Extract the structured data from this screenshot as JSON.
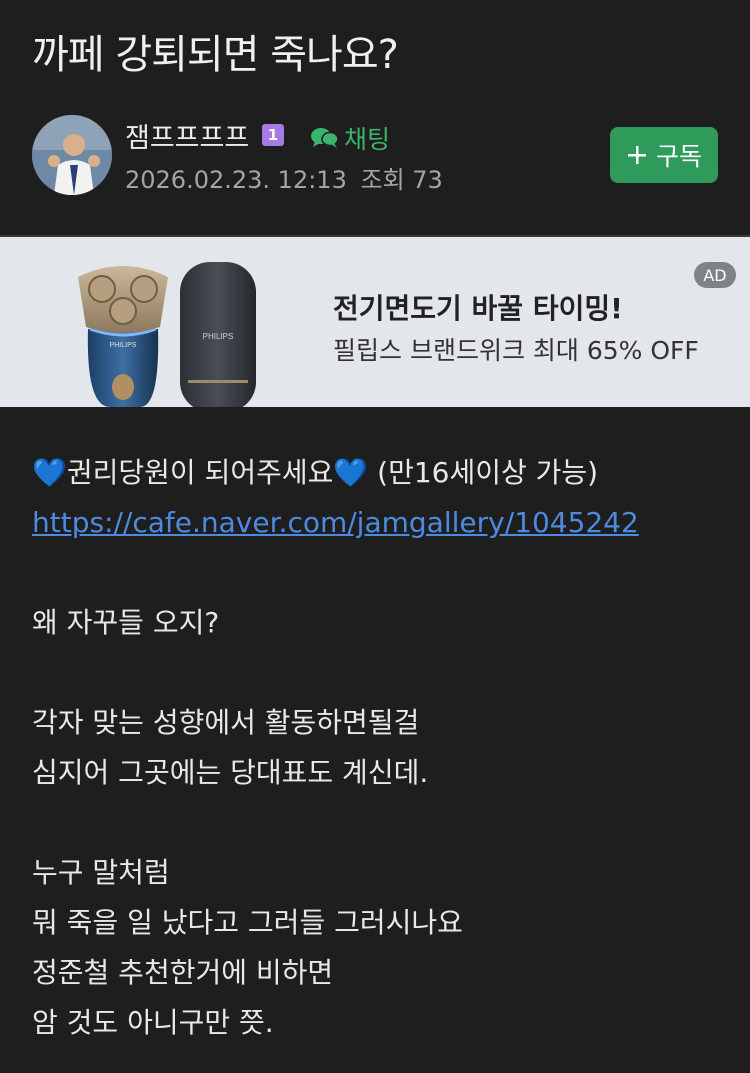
{
  "post": {
    "title": "까페 강퇴되면 죽나요?"
  },
  "author": {
    "name": "잼프프프프",
    "level": "1",
    "chat_label": "채팅",
    "date": "2026.02.23. 12:13",
    "views_label": "조회 73",
    "subscribe_label": "구독"
  },
  "ad": {
    "headline": "전기면도기 바꿀 타이밍!",
    "subline": "필립스 브랜드위크 최대 65% OFF",
    "badge": "AD",
    "brand": "PHILIPS"
  },
  "content": {
    "notice_text": "권리당원이 되어주세요",
    "notice_suffix": " (만16세이상 가능)",
    "link": "https://cafe.naver.com/jamgallery/1045242",
    "lines": [
      "왜 자꾸들 오지?",
      "",
      "각자 맞는 성향에서 활동하면될걸",
      "심지어 그곳에는 당대표도 계신데.",
      "",
      "누구 말처럼",
      "뭐 죽을 일 났다고 그러들 그러시나요",
      "정준철 추천한거에 비하면",
      "암 것도 아니구만 쯧."
    ]
  },
  "colors": {
    "background": "#1e1e1f",
    "accent_green": "#2f9b5a",
    "chat_green": "#3bb56b",
    "link_blue": "#4d8ae0",
    "level_purple": "#a77be4"
  }
}
